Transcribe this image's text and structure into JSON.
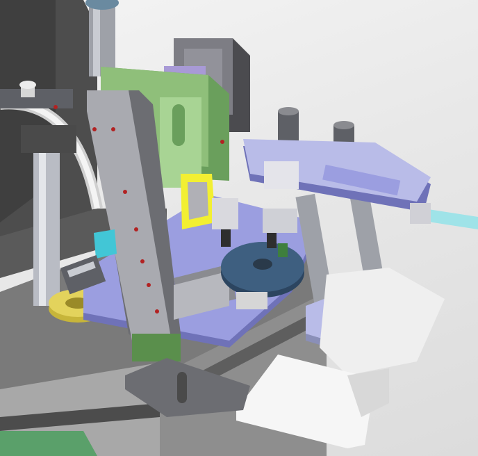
{
  "viewport": {
    "background_top": "#f4f4f4",
    "background_bottom": "#dcdcdc"
  },
  "colors": {
    "frame_dark": "#4a4a4a",
    "frame_mid": "#6d6d6d",
    "steel_light": "#b9bcc4",
    "steel_mid": "#9ea1a8",
    "steel_dark": "#5e6066",
    "lavender": "#9b9ee0",
    "lavender_dark": "#6f72b8",
    "green_plate": "#8fbf7a",
    "green_dark": "#4f7d45",
    "sage": "#c6d8b3",
    "yellow": "#e3d35c",
    "yellow_bright": "#f2ef32",
    "cyan": "#42c6d6",
    "turntable_blue": "#3e5f80",
    "red_hole": "#b22222",
    "white_plate": "#f6f6f6",
    "motor_gray": "#7d7d84"
  },
  "parts": [
    {
      "name": "base-frame",
      "material": "dark-steel"
    },
    {
      "name": "lifting-plate-vertical",
      "material": "gray-steel"
    },
    {
      "name": "stepper-motor",
      "material": "motor-gray"
    },
    {
      "name": "linear-slide-arm",
      "material": "lavender-alloy"
    },
    {
      "name": "rotary-turntable",
      "material": "blue-anodized"
    },
    {
      "name": "yellow-disc-flange",
      "material": "yellow"
    },
    {
      "name": "support-column-pair",
      "material": "polished-steel"
    },
    {
      "name": "white-mount-plate",
      "material": "white"
    }
  ]
}
